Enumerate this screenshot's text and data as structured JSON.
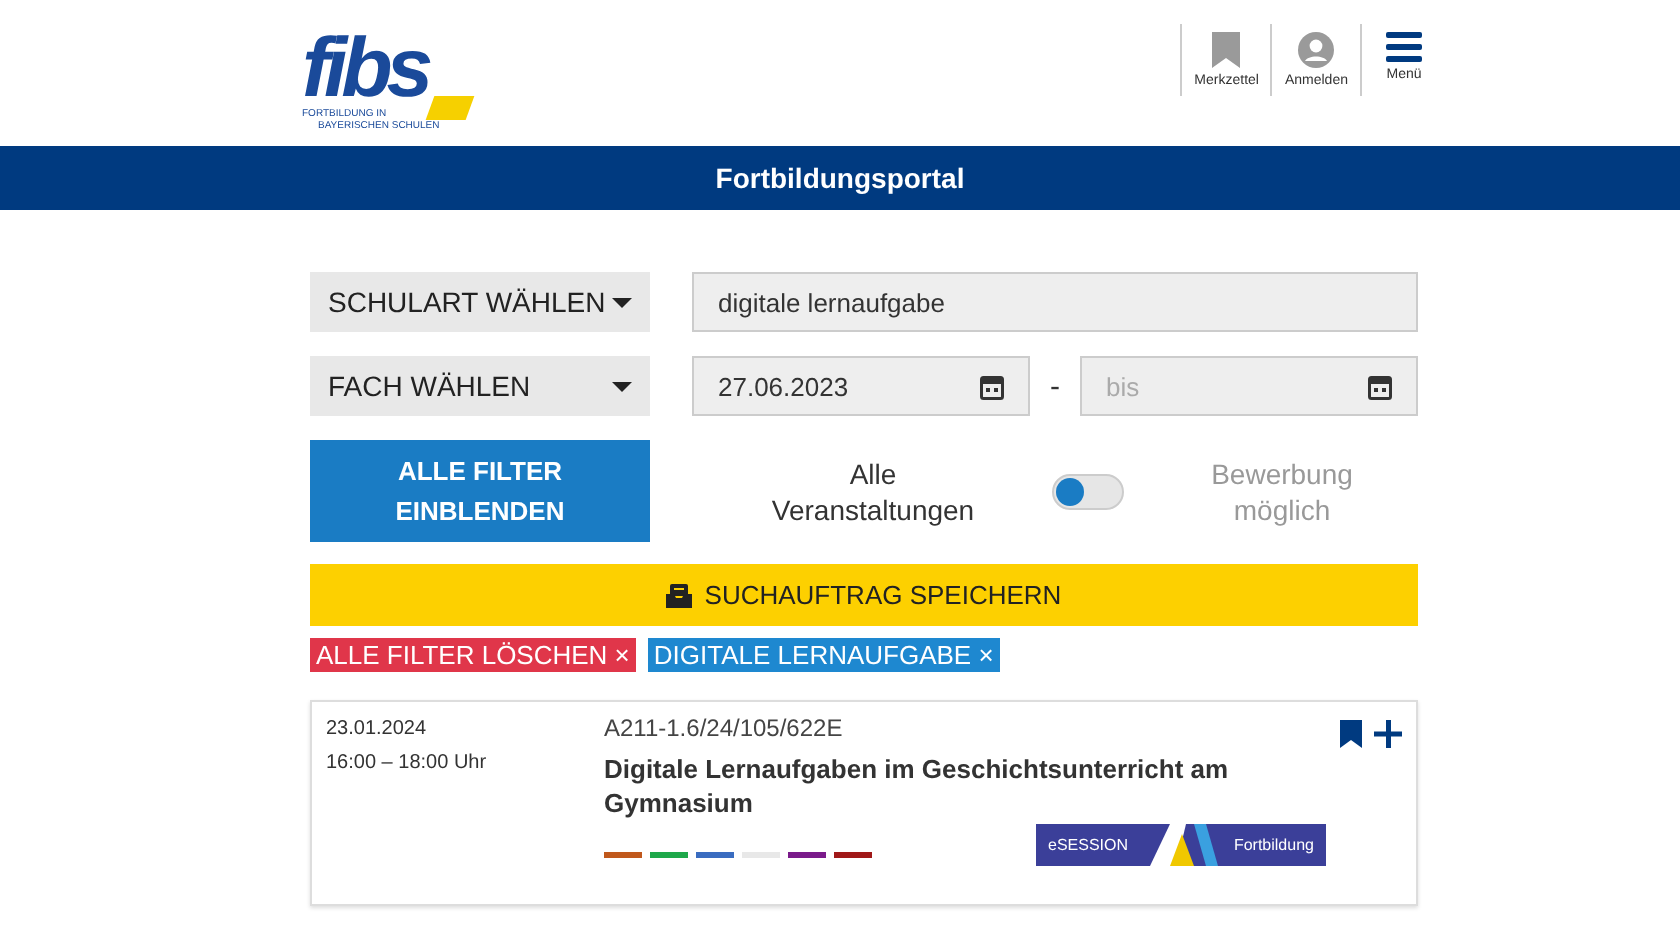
{
  "header": {
    "logo": {
      "word": "fibs",
      "tagline_1": "FORTBILDUNG IN",
      "tagline_2": "BAYERISCHEN SCHULEN"
    },
    "actions": [
      {
        "kind": "bookmark",
        "label": "Merkzettel"
      },
      {
        "kind": "user",
        "label": "Anmelden"
      },
      {
        "kind": "menu",
        "label": "Menü"
      }
    ]
  },
  "banner": {
    "title": "Fortbildungsportal"
  },
  "filters": {
    "school_type": "SCHULART WÄHLEN",
    "subject": "FACH WÄHLEN",
    "search": {
      "value": "digitale lernaufgabe"
    },
    "date_from": {
      "value": "27.06.2023"
    },
    "date_separator": "-",
    "date_to": {
      "placeholder": "bis"
    },
    "show_all_button": "ALLE FILTER EINBLENDEN",
    "toggle": {
      "left_label": "Alle Veranstaltungen",
      "right_label": "Bewerbung möglich",
      "on": false
    },
    "save_button": "SUCHAUFTRAG SPEICHERN"
  },
  "tags": [
    {
      "label": "ALLE FILTER LÖSCHEN",
      "remove": "×",
      "color": "#e0364a"
    },
    {
      "label": "DIGITALE LERNAUFGABE",
      "remove": "×",
      "color": "#1e88d0"
    }
  ],
  "results": [
    {
      "date": "23.01.2024",
      "time": "16:00 – 18:00 Uhr",
      "code": "A211-1.6/24/105/622E",
      "title": "Digitale Lernaufgaben im Geschichtsunterricht am Gymnasium",
      "subject_colors": [
        {
          "color": "#c0581c"
        },
        {
          "color": "#1ea84a"
        },
        {
          "color": "#3a6cc0"
        },
        {
          "color": "#e8e8e8"
        },
        {
          "color": "#7a1a8a"
        },
        {
          "color": "#a01818"
        }
      ],
      "format_left": "eSESSION",
      "format_right": "Fortbildung"
    }
  ]
}
